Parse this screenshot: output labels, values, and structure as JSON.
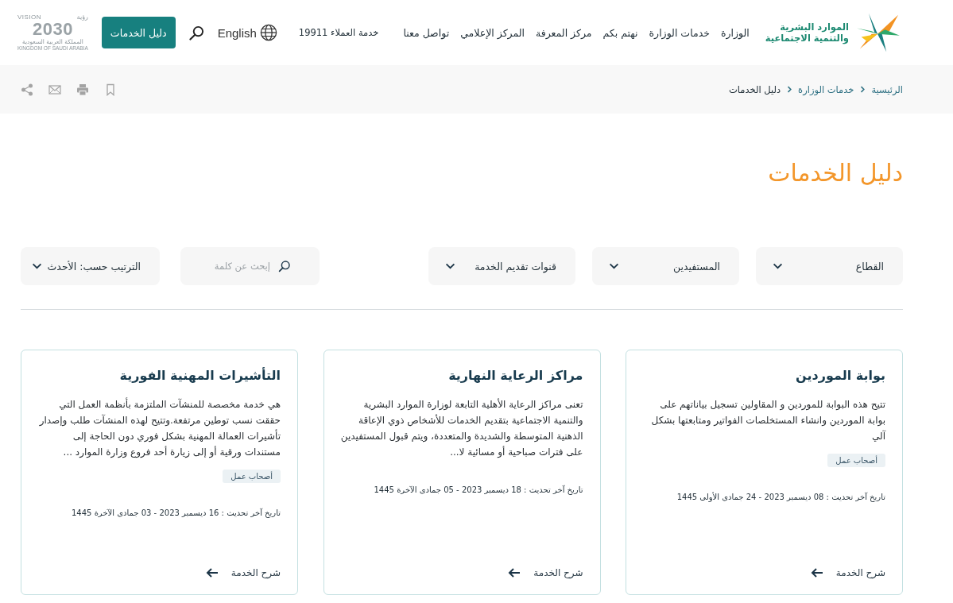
{
  "header": {
    "logo_lines": [
      "الموارد البشرية",
      "والتنمية الاجتماعية"
    ],
    "nav": [
      {
        "label": "الوزارة"
      },
      {
        "label": "خدمات الوزارة"
      },
      {
        "label": "نهتم بكم"
      },
      {
        "label": "مركز المعرفة"
      },
      {
        "label": "المركز الإعلامي"
      },
      {
        "label": "تواصل معنا"
      }
    ],
    "customer_service": "خدمة العملاء 19911",
    "language": "English",
    "guide_button": "دليل الخدمات",
    "vision_logo": {
      "arabic": "رؤية",
      "word": "VISION",
      "year": "2030",
      "country_ar": "المملكة العربية السعودية",
      "country_en": "KINGDOM OF SAUDI ARABIA"
    }
  },
  "breadcrumb": [
    {
      "label": "الرئيسية",
      "current": false
    },
    {
      "label": "خدمات الوزارة",
      "current": false
    },
    {
      "label": "دليل الخدمات",
      "current": true
    }
  ],
  "page_title": "دليل الخدمات",
  "filters": [
    {
      "label": "القطاع"
    },
    {
      "label": "المستفيدين"
    },
    {
      "label": "قنوات تقديم الخدمة"
    }
  ],
  "search": {
    "placeholder": "إبحث عن كلمة"
  },
  "sort": {
    "label": "الترتيب حسب: الأحدث"
  },
  "cards": [
    {
      "title": "بوابة الموردين",
      "description": "تتيح هذه البوابة للموردين و المقاولين تسجيل بياناتهم على بوابة الموردين وانشاء المستخلصات الفواتير ومتابعتها بشكل آلي",
      "tags": [
        "أصحاب عمل"
      ],
      "updated": "تاريخ آخر تحديث : 08 ديسمبر 2023 - 24 جمادى الأولى 1445",
      "link": "شرح الخدمة"
    },
    {
      "title": "مراكز الرعاية النهارية",
      "description": "تعنى مراكز الرعاية الأهلية التابعة لوزارة الموارد البشرية والتنمية الاجتماعية بتقديم الخدمات للأشخاص ذوي الإعاقة الذهنية المتوسطة والشديدة والمتعددة، ويتم قبول المستفيدين على فترات صباحية أو مسائية لا...",
      "updated": "تاريخ آخر تحديث : 18 ديسمبر 2023 - 05 جمادى الآخرة 1445",
      "link": "شرح الخدمة"
    },
    {
      "title": "التأشيرات المهنية الفورية",
      "description": "هي خدمة مخصصة للمنشآت الملتزمة بأنظمة العمل التي حققت نسب توطين مرتفعة.وتتيح لهذه المنشآت طلب وإصدار تأشيرات العمالة المهنية بشكل فوري دون الحاجة إلى مستندات ورقية أو إلى زيارة أحد فروع وزارة الموارد ...",
      "tags": [
        "أصحاب عمل"
      ],
      "updated": "تاريخ آخر تحديث : 16 ديسمبر 2023 - 03 جمادى الآخرة 1445",
      "link": "شرح الخدمة"
    }
  ]
}
